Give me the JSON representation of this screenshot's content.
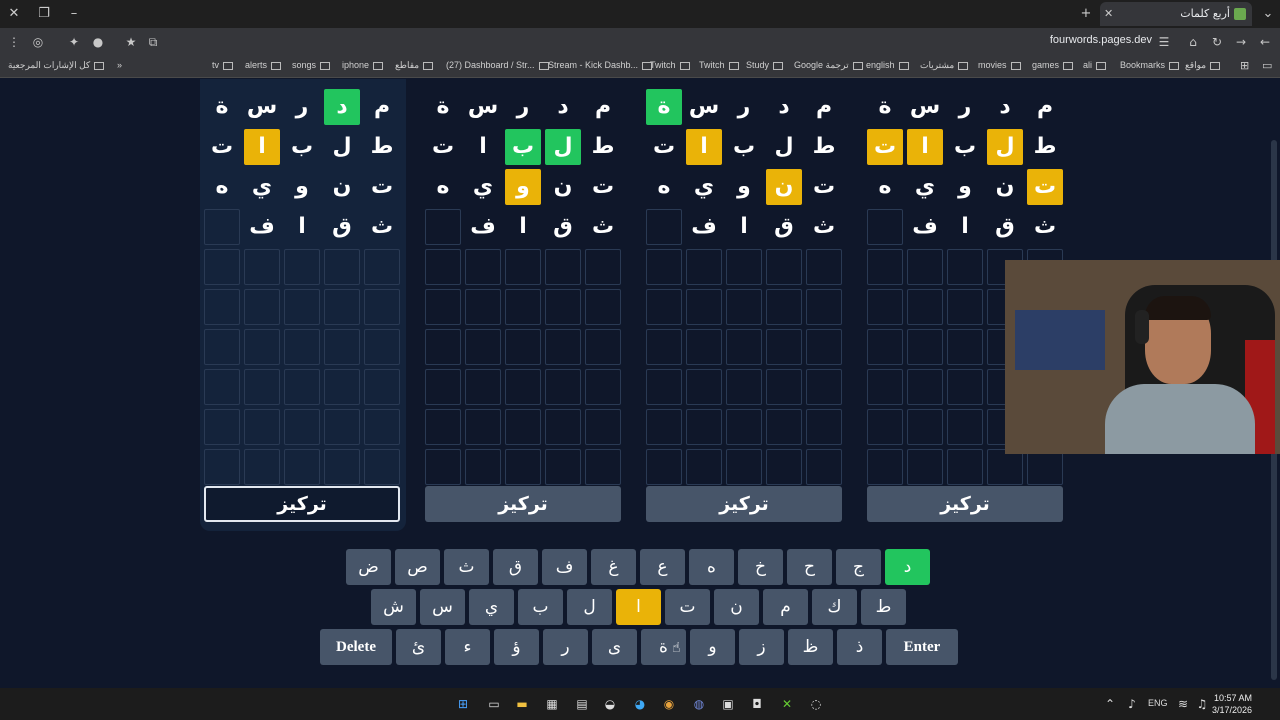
{
  "browser": {
    "tab_title": "أربع كلمات",
    "url": "fourwords.pages.dev",
    "bookmarks": [
      "مواقع",
      "Bookmarks",
      "ali",
      "games",
      "movies",
      "مشتريات",
      "english",
      "Google ترجمة",
      "Study",
      "Twitch",
      "Twitch",
      "Stream - Kick Dashb...",
      "(27) Dashboard / Str...",
      "مقاطع",
      "iphone",
      "songs",
      "alerts",
      "tv"
    ],
    "all_bookmarks": "كل الإشارات المرجعية"
  },
  "boards": [
    {
      "rows": [
        [
          {
            "l": "م",
            "s": "f"
          },
          {
            "l": "د",
            "s": "g"
          },
          {
            "l": "ر",
            "s": "f"
          },
          {
            "l": "س",
            "s": "f"
          },
          {
            "l": "ة",
            "s": "f"
          }
        ],
        [
          {
            "l": "ط",
            "s": "f"
          },
          {
            "l": "ل",
            "s": "f"
          },
          {
            "l": "ب",
            "s": "f"
          },
          {
            "l": "ا",
            "s": "y"
          },
          {
            "l": "ت",
            "s": "f"
          }
        ],
        [
          {
            "l": "ت",
            "s": "f"
          },
          {
            "l": "ن",
            "s": "f"
          },
          {
            "l": "و",
            "s": "f"
          },
          {
            "l": "ي",
            "s": "f"
          },
          {
            "l": "ه",
            "s": "f"
          }
        ],
        [
          {
            "l": "ث",
            "s": "f"
          },
          {
            "l": "ق",
            "s": "f"
          },
          {
            "l": "ا",
            "s": "f"
          },
          {
            "l": "ف",
            "s": "f"
          },
          {
            "l": "",
            "s": "e"
          }
        ]
      ],
      "focus_label": "تركيز"
    },
    {
      "rows": [
        [
          {
            "l": "م",
            "s": "f"
          },
          {
            "l": "د",
            "s": "f"
          },
          {
            "l": "ر",
            "s": "f"
          },
          {
            "l": "س",
            "s": "f"
          },
          {
            "l": "ة",
            "s": "f"
          }
        ],
        [
          {
            "l": "ط",
            "s": "f"
          },
          {
            "l": "ل",
            "s": "g"
          },
          {
            "l": "ب",
            "s": "g"
          },
          {
            "l": "ا",
            "s": "f"
          },
          {
            "l": "ت",
            "s": "f"
          }
        ],
        [
          {
            "l": "ت",
            "s": "f"
          },
          {
            "l": "ن",
            "s": "f"
          },
          {
            "l": "و",
            "s": "y"
          },
          {
            "l": "ي",
            "s": "f"
          },
          {
            "l": "ه",
            "s": "f"
          }
        ],
        [
          {
            "l": "ث",
            "s": "f"
          },
          {
            "l": "ق",
            "s": "f"
          },
          {
            "l": "ا",
            "s": "f"
          },
          {
            "l": "ف",
            "s": "f"
          },
          {
            "l": "",
            "s": "e"
          }
        ]
      ],
      "focus_label": "تركيز"
    },
    {
      "rows": [
        [
          {
            "l": "م",
            "s": "f"
          },
          {
            "l": "د",
            "s": "f"
          },
          {
            "l": "ر",
            "s": "f"
          },
          {
            "l": "س",
            "s": "f"
          },
          {
            "l": "ة",
            "s": "g"
          }
        ],
        [
          {
            "l": "ط",
            "s": "f"
          },
          {
            "l": "ل",
            "s": "f"
          },
          {
            "l": "ب",
            "s": "f"
          },
          {
            "l": "ا",
            "s": "y"
          },
          {
            "l": "ت",
            "s": "f"
          }
        ],
        [
          {
            "l": "ت",
            "s": "f"
          },
          {
            "l": "ن",
            "s": "y"
          },
          {
            "l": "و",
            "s": "f"
          },
          {
            "l": "ي",
            "s": "f"
          },
          {
            "l": "ه",
            "s": "f"
          }
        ],
        [
          {
            "l": "ث",
            "s": "f"
          },
          {
            "l": "ق",
            "s": "f"
          },
          {
            "l": "ا",
            "s": "f"
          },
          {
            "l": "ف",
            "s": "f"
          },
          {
            "l": "",
            "s": "e"
          }
        ]
      ],
      "focus_label": "تركيز"
    },
    {
      "rows": [
        [
          {
            "l": "م",
            "s": "f"
          },
          {
            "l": "د",
            "s": "f"
          },
          {
            "l": "ر",
            "s": "f"
          },
          {
            "l": "س",
            "s": "f"
          },
          {
            "l": "ة",
            "s": "f"
          }
        ],
        [
          {
            "l": "ط",
            "s": "f"
          },
          {
            "l": "ل",
            "s": "y"
          },
          {
            "l": "ب",
            "s": "f"
          },
          {
            "l": "ا",
            "s": "y"
          },
          {
            "l": "ت",
            "s": "y"
          }
        ],
        [
          {
            "l": "ت",
            "s": "y"
          },
          {
            "l": "ن",
            "s": "f"
          },
          {
            "l": "و",
            "s": "f"
          },
          {
            "l": "ي",
            "s": "f"
          },
          {
            "l": "ه",
            "s": "f"
          }
        ],
        [
          {
            "l": "ث",
            "s": "f"
          },
          {
            "l": "ق",
            "s": "f"
          },
          {
            "l": "ا",
            "s": "f"
          },
          {
            "l": "ف",
            "s": "f"
          },
          {
            "l": "",
            "s": "e"
          }
        ]
      ],
      "focus_label": "تركيز"
    }
  ],
  "keyboard": {
    "row1": [
      {
        "k": "د",
        "s": "g"
      },
      {
        "k": "ج",
        "s": "n"
      },
      {
        "k": "ح",
        "s": "n"
      },
      {
        "k": "خ",
        "s": "n"
      },
      {
        "k": "ه",
        "s": "n"
      },
      {
        "k": "ع",
        "s": "n"
      },
      {
        "k": "غ",
        "s": "n"
      },
      {
        "k": "ف",
        "s": "n"
      },
      {
        "k": "ق",
        "s": "n"
      },
      {
        "k": "ث",
        "s": "n"
      },
      {
        "k": "ص",
        "s": "n"
      },
      {
        "k": "ض",
        "s": "n"
      }
    ],
    "row2": [
      {
        "k": "ط",
        "s": "n"
      },
      {
        "k": "ك",
        "s": "n"
      },
      {
        "k": "م",
        "s": "n"
      },
      {
        "k": "ن",
        "s": "n"
      },
      {
        "k": "ت",
        "s": "n"
      },
      {
        "k": "ا",
        "s": "y"
      },
      {
        "k": "ل",
        "s": "n"
      },
      {
        "k": "ب",
        "s": "n"
      },
      {
        "k": "ي",
        "s": "n"
      },
      {
        "k": "س",
        "s": "n"
      },
      {
        "k": "ش",
        "s": "n"
      }
    ],
    "row3": [
      {
        "k": "Enter",
        "s": "n"
      },
      {
        "k": "ذ",
        "s": "n"
      },
      {
        "k": "ظ",
        "s": "n"
      },
      {
        "k": "ز",
        "s": "n"
      },
      {
        "k": "و",
        "s": "n"
      },
      {
        "k": "ة",
        "s": "n"
      },
      {
        "k": "ى",
        "s": "n"
      },
      {
        "k": "ر",
        "s": "n"
      },
      {
        "k": "ؤ",
        "s": "n"
      },
      {
        "k": "ء",
        "s": "n"
      },
      {
        "k": "ئ",
        "s": "n"
      },
      {
        "k": "Delete",
        "s": "n"
      }
    ]
  },
  "taskbar": {
    "lang": "ENG",
    "time": "10:57 AM",
    "date": "3/17/2026"
  },
  "colors": {
    "green": "#22c55e",
    "yellow": "#eab308",
    "key_bg": "#475569",
    "background": "#0f172a"
  }
}
